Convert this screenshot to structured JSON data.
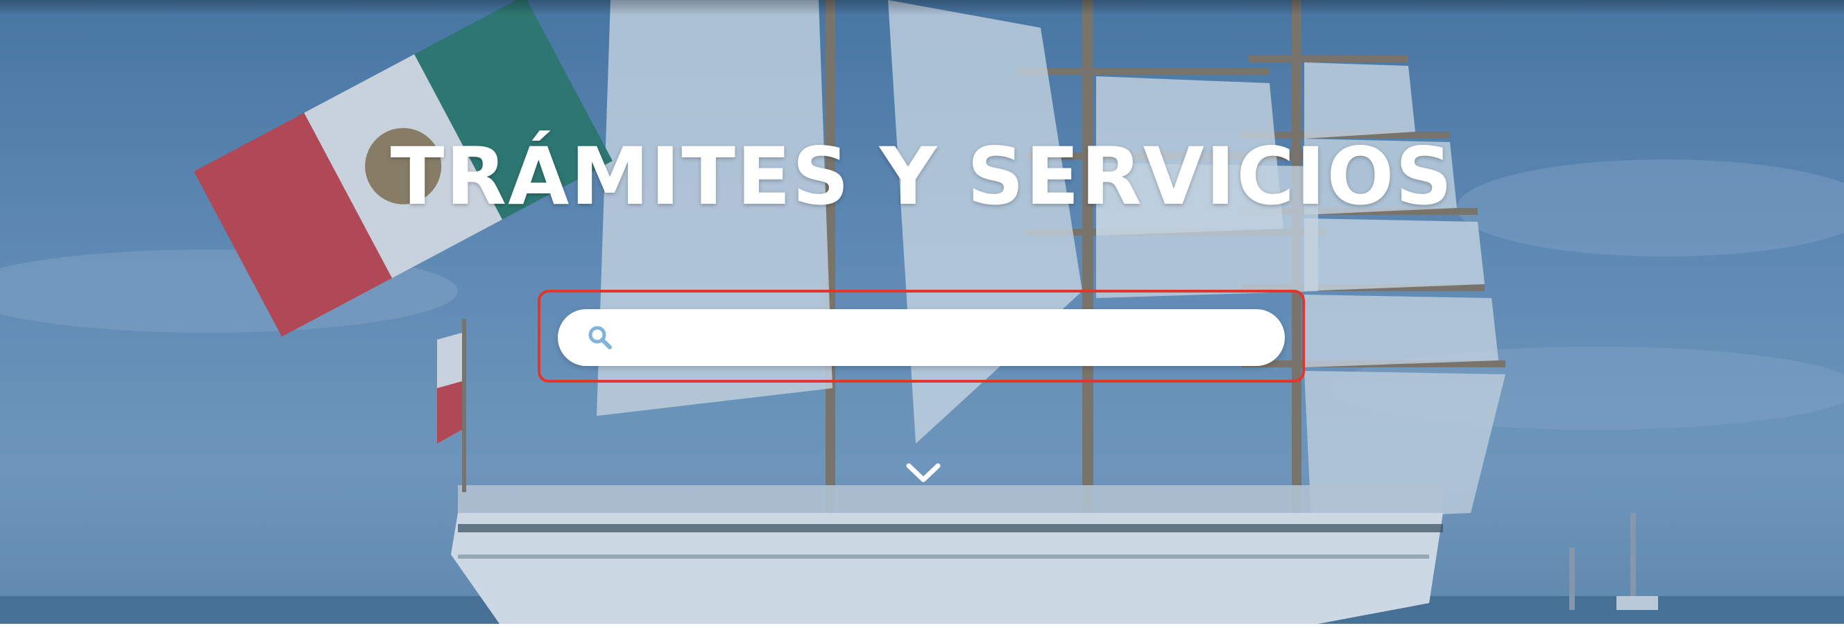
{
  "hero": {
    "title": "TRÁMITES Y SERVICIOS",
    "background_image": "tall-ship-with-mexican-flag",
    "overlay_color": "#5b86b3"
  },
  "search": {
    "placeholder": "",
    "value": "",
    "icon": "search-icon",
    "icon_color": "#7fb3d9",
    "highlight_color": "#e0372a"
  },
  "scroll_down": {
    "icon": "chevron-down-icon"
  }
}
